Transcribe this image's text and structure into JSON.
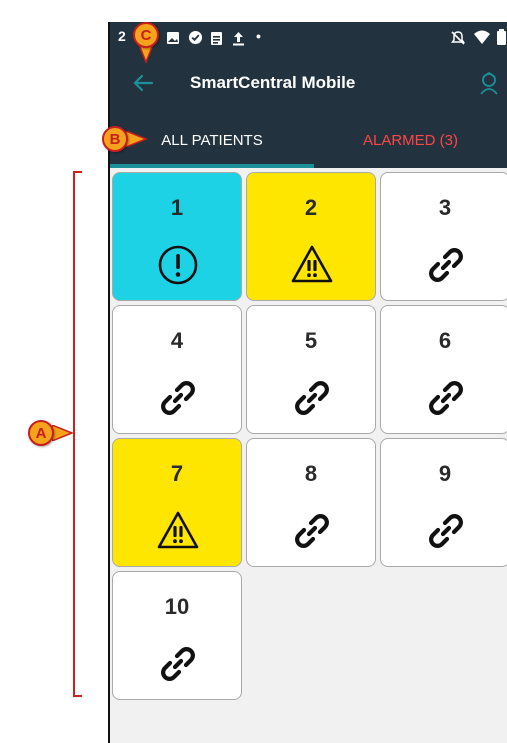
{
  "status_bar": {
    "time_fragment": "2",
    "dot": "•"
  },
  "app_bar": {
    "title": "SmartCentral Mobile"
  },
  "tabs": [
    {
      "label": "ALL PATIENTS",
      "active": true
    },
    {
      "label": "ALARMED (3)",
      "active": false
    }
  ],
  "beds": [
    {
      "number": "1",
      "status": "alert",
      "color": "#1ed2e6",
      "icon": "exclamation-circle-icon"
    },
    {
      "number": "2",
      "status": "warning",
      "color": "#ffe600",
      "icon": "warning-triangle-icon"
    },
    {
      "number": "3",
      "status": "connected",
      "color": "#ffffff",
      "icon": "link-icon"
    },
    {
      "number": "4",
      "status": "connected",
      "color": "#ffffff",
      "icon": "link-icon"
    },
    {
      "number": "5",
      "status": "connected",
      "color": "#ffffff",
      "icon": "link-icon"
    },
    {
      "number": "6",
      "status": "connected",
      "color": "#ffffff",
      "icon": "link-icon"
    },
    {
      "number": "7",
      "status": "warning",
      "color": "#ffe600",
      "icon": "warning-triangle-icon"
    },
    {
      "number": "8",
      "status": "connected",
      "color": "#ffffff",
      "icon": "link-icon"
    },
    {
      "number": "9",
      "status": "connected",
      "color": "#ffffff",
      "icon": "link-icon"
    },
    {
      "number": "10",
      "status": "connected",
      "color": "#ffffff",
      "icon": "link-icon"
    }
  ],
  "annotations": {
    "a": "A",
    "b": "B",
    "c": "C"
  },
  "colors": {
    "bar": "#22333f",
    "accent": "#1c8f98",
    "alarm_text": "#ff4545",
    "annotation": "#c81e1e",
    "annotation_fill": "#f5a31a"
  }
}
